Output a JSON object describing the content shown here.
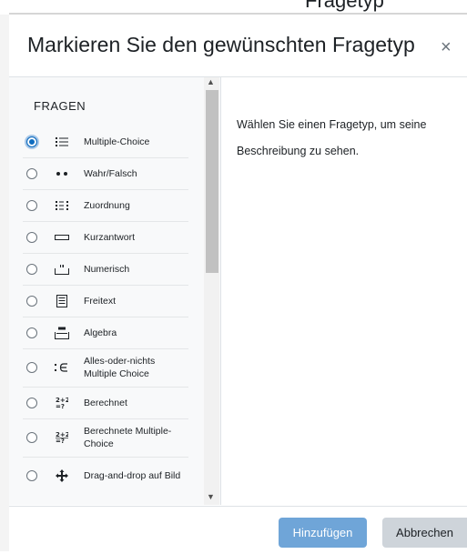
{
  "background_title_fragment": "Fragetyp",
  "modal": {
    "title": "Markieren Sie den gewünschten Fragetyp",
    "close_symbol": "×"
  },
  "list": {
    "heading": "FRAGEN",
    "selected_index": 0,
    "items": [
      {
        "label": "Multiple-Choice",
        "icon": "list-icon"
      },
      {
        "label": "Wahr/Falsch",
        "icon": "two-dots-icon"
      },
      {
        "label": "Zuordnung",
        "icon": "matching-icon"
      },
      {
        "label": "Kurzantwort",
        "icon": "short-answer-icon"
      },
      {
        "label": "Numerisch",
        "icon": "numerical-icon"
      },
      {
        "label": "Freitext",
        "icon": "essay-icon"
      },
      {
        "label": "Algebra",
        "icon": "algebra-icon"
      },
      {
        "label": "Alles-oder-nichts Multiple Choice",
        "icon": "all-or-nothing-icon"
      },
      {
        "label": "Berechnet",
        "icon": "calculated-icon"
      },
      {
        "label": "Berechnete Multiple-Choice",
        "icon": "calculated-multichoice-icon"
      },
      {
        "label": "Drag-and-drop auf Bild",
        "icon": "move-cross-icon"
      }
    ]
  },
  "description": "Wählen Sie einen Fragetyp, um seine Beschreibung zu sehen.",
  "footer": {
    "add_label": "Hinzufügen",
    "cancel_label": "Abbrechen"
  },
  "colors": {
    "primary": "#0f6cbf",
    "primary_disabled": "#6fa5d8",
    "secondary": "#ced4da"
  }
}
